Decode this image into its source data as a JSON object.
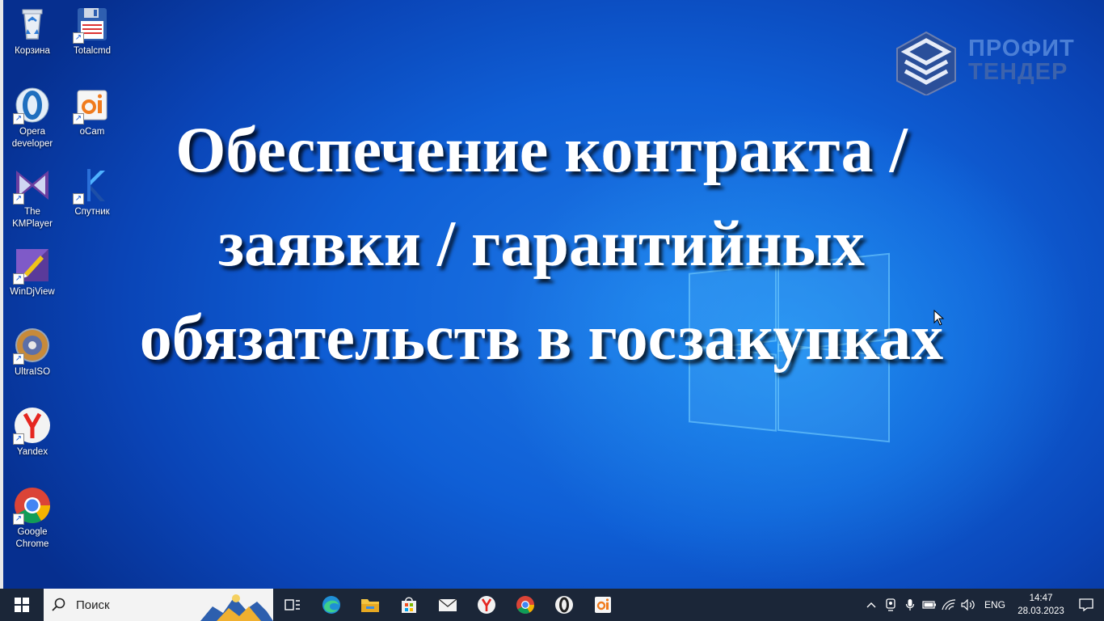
{
  "desktop": {
    "icons": [
      {
        "label": "Корзина"
      },
      {
        "label": "Totalcmd"
      },
      {
        "label": "Opera developer"
      },
      {
        "label": "oCam"
      },
      {
        "label": "The KMPlayer"
      },
      {
        "label": "Спутник"
      },
      {
        "label": "WinDjView"
      },
      {
        "label": "UltraISO"
      },
      {
        "label": "Yandex"
      },
      {
        "label": "Google Chrome"
      }
    ],
    "headline": "Обеспечение контракта / заявки / гарантийных обязательств в госзакупках",
    "brand": {
      "line1": "ПРОФИТ",
      "line2": "ТЕНДЕР"
    }
  },
  "taskbar": {
    "search_placeholder": "Поиск",
    "pinned": [
      "task-view-icon",
      "edge-icon",
      "file-explorer-icon",
      "store-icon",
      "mail-icon",
      "yandex-browser-icon",
      "chrome-icon",
      "opera-icon",
      "ocam-icon"
    ],
    "tray": {
      "lang": "ENG",
      "time": "14:47",
      "date": "28.03.2023"
    }
  }
}
